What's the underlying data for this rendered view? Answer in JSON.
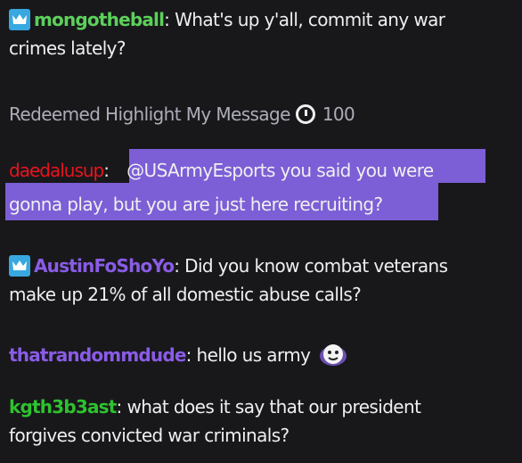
{
  "colors": {
    "background": "#18181b",
    "text": "#efeff1",
    "muted": "#adadb8",
    "highlight": "#7c5ed6",
    "badge": "#38a8e0"
  },
  "messages": [
    {
      "user": "mongotheball",
      "color": "#5cd05a",
      "badge": "crown-icon",
      "text_line1": "What's up y'all, commit any war",
      "text_line2": "crimes lately?"
    },
    {
      "system": "Redeemed Highlight My Message",
      "points": "100"
    },
    {
      "user": "daedalusup",
      "color": "#e8141e",
      "text_line1": "@USArmyEsports you said you were",
      "text_line2": "gonna play, but you are just here recruiting?"
    },
    {
      "user": "AustinFoShoYo",
      "color": "#8a5ce6",
      "badge": "crown-icon",
      "text_line1": "Did you know combat veterans",
      "text_line2": "make up 21% of all domestic abuse calls?"
    },
    {
      "user": "thatrandommdude",
      "color": "#8a5ce6",
      "text_line1": "hello us army",
      "emote": "ghost-face-emote"
    },
    {
      "user": "kgth3b3ast",
      "color": "#2ec22e",
      "text_line1": "what does it say that our president",
      "text_line2": "forgives convicted war criminals?"
    }
  ]
}
